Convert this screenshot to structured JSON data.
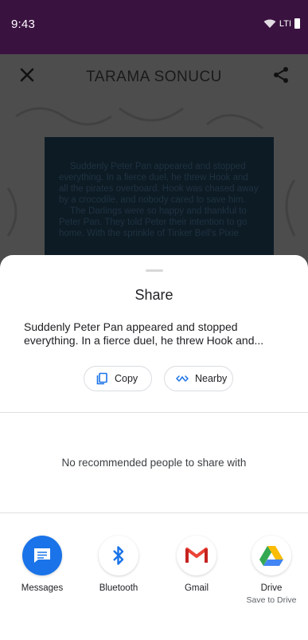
{
  "status": {
    "time": "9:43",
    "network": "LTI"
  },
  "app": {
    "title": "TARAMA SONUCU",
    "paragraph1": "Suddenly Peter Pan appeared and stopped everything. In a fierce duel, he threw Hook and all the pirates overboard. Hook was chased away by a crocodile, and nobody cared to save him.",
    "paragraph2": "The Darlings were so happy and thankful to Peter Pan. They told Peter their intention to go home. With the sprinkle of Tinker Bell's Pixie"
  },
  "share": {
    "title": "Share",
    "preview": "Suddenly Peter Pan appeared and stopped everything. In a fierce duel, he threw Hook and...",
    "copy_label": "Copy",
    "nearby_label": "Nearby",
    "no_people": "No recommended people to share with",
    "apps": [
      {
        "label": "Messages",
        "sub": ""
      },
      {
        "label": "Bluetooth",
        "sub": ""
      },
      {
        "label": "Gmail",
        "sub": ""
      },
      {
        "label": "Drive",
        "sub": "Save to Drive"
      }
    ]
  },
  "colors": {
    "status_bar": "#3a1240",
    "messages": "#1a73e8",
    "bluetooth": "#1a73e8",
    "gmail": "#ea4335"
  }
}
